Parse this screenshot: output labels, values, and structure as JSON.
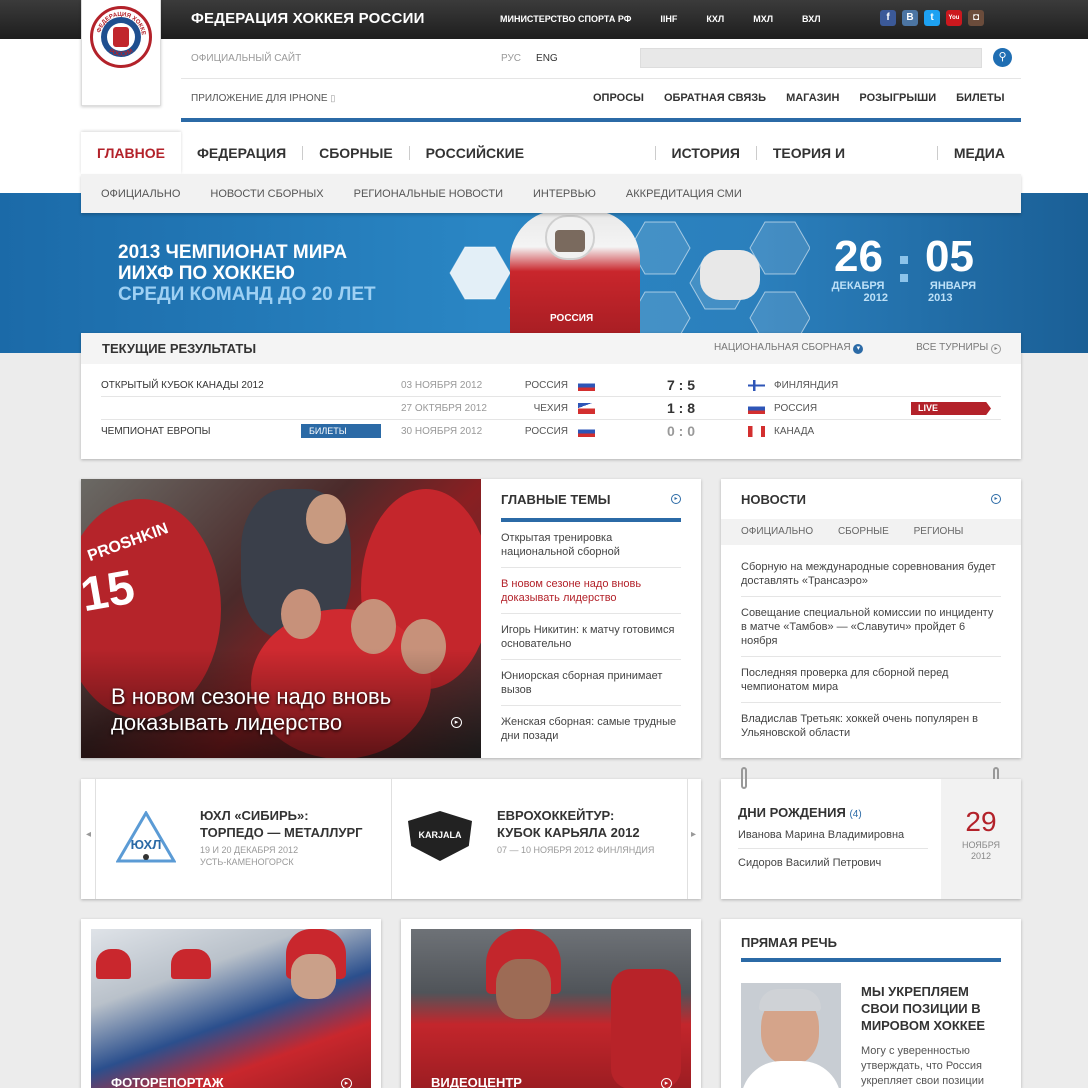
{
  "header": {
    "title": "ФЕДЕРАЦИЯ ХОККЕЯ РОССИИ",
    "links": [
      "МИНИСТЕРСТВО СПОРТА РФ",
      "IIHF",
      "КХЛ",
      "МХЛ",
      "ВХЛ"
    ],
    "social": [
      {
        "name": "facebook-icon",
        "glyph": "f",
        "color": "#3b5998"
      },
      {
        "name": "vkontakte-icon",
        "glyph": "B",
        "color": "#4c75a3"
      },
      {
        "name": "twitter-icon",
        "glyph": "t",
        "color": "#1da1f2"
      },
      {
        "name": "youtube-icon",
        "glyph": "You",
        "color": "#cc181e"
      },
      {
        "name": "instagram-icon",
        "glyph": "◘",
        "color": "#6b4c3b"
      }
    ],
    "official_site": "ОФИЦИАЛЬНЫЙ САЙТ",
    "lang_ru": "РУС",
    "lang_en": "ENG",
    "iphone_app": "ПРИЛОЖЕНИЕ ДЛЯ IPHONE",
    "util_links": [
      "ОПРОСЫ",
      "ОБРАТНАЯ СВЯЗЬ",
      "МАГАЗИН",
      "РОЗЫГРЫШИ",
      "БИЛЕТЫ"
    ],
    "logo_text": "ФЕДЕРАЦИЯ ХОККЕЯ РОССИИ"
  },
  "nav": {
    "main": [
      "ГЛАВНОЕ",
      "ФЕДЕРАЦИЯ",
      "СБОРНЫЕ",
      "РОССИЙСКИЕ СОРЕВНОВАНИЯ",
      "ИСТОРИЯ",
      "ТЕОРИЯ И МЕТОДИКА",
      "МЕДИА"
    ],
    "sub": [
      "ОФИЦИАЛЬНО",
      "НОВОСТИ СБОРНЫХ",
      "РЕГИОНАЛЬНЫЕ НОВОСТИ",
      "ИНТЕРВЬЮ",
      "АККРЕДИТАЦИЯ СМИ"
    ]
  },
  "banner": {
    "line1": "2013 ЧЕМПИОНАТ МИРА",
    "line2": "ИИХФ ПО ХОККЕЮ",
    "line3": "СРЕДИ КОМАНД ДО 20 ЛЕТ",
    "start_day": "26",
    "start_month": "ДЕКАБРЯ",
    "start_year": "2012",
    "end_day": "05",
    "end_month": "ЯНВАРЯ",
    "end_year": "2013",
    "jersey_text": "РОССИЯ"
  },
  "results": {
    "title": "ТЕКУЩИЕ РЕЗУЛЬТАТЫ",
    "filter": "НАЦИОНАЛЬНАЯ СБОРНАЯ",
    "all": "ВСЕ ТУРНИРЫ",
    "rows": [
      {
        "tournament": "ОТКРЫТЫЙ КУБОК КАНАДЫ 2012",
        "tickets": "",
        "date": "03 НОЯБРЯ 2012",
        "team1": "РОССИЯ",
        "flag1": "ru",
        "score": "7 : 5",
        "flag2": "fi",
        "team2": "ФИНЛЯНДИЯ",
        "live": ""
      },
      {
        "tournament": "",
        "tickets": "",
        "date": "27 ОКТЯБРЯ 2012",
        "team1": "ЧЕХИЯ",
        "flag1": "cz",
        "score": "1 : 8",
        "flag2": "ru",
        "team2": "РОССИЯ",
        "live": "LIVE"
      },
      {
        "tournament": "ЧЕМПИОНАТ ЕВРОПЫ",
        "tickets": "БИЛЕТЫ",
        "date": "30 НОЯБРЯ 2012",
        "team1": "РОССИЯ",
        "flag1": "ru",
        "score": "0 : 0",
        "flag2": "ca",
        "team2": "КАНАДА",
        "live": ""
      }
    ]
  },
  "feature": {
    "caption": "В новом сезоне надо вновь доказывать лидерство",
    "jersey_name": "PROSHKIN",
    "jersey_num": "15"
  },
  "topics": {
    "title": "ГЛАВНЫЕ ТЕМЫ",
    "items": [
      {
        "text": "Открытая тренировка национальной сборной",
        "hl": false
      },
      {
        "text": "В новом сезоне надо вновь доказывать лидерство",
        "hl": true
      },
      {
        "text": "Игорь Никитин: к матчу готовимся основательно",
        "hl": false
      },
      {
        "text": "Юниорская сборная принимает вызов",
        "hl": false
      },
      {
        "text": "Женская сборная: самые трудные дни позади",
        "hl": false
      }
    ]
  },
  "news": {
    "title": "НОВОСТИ",
    "tabs": [
      "ОФИЦИАЛЬНО",
      "СБОРНЫЕ",
      "РЕГИОНЫ"
    ],
    "items": [
      "Сборную на международные соревнования будет доставлять «Трансаэро»",
      "Совещание специальной комиссии по инциденту в матче «Тамбов» — «Славутич» пройдет 6 ноября",
      "Последняя проверка для сборной перед чемпионатом мира",
      "Владислав Третьяк: хоккей очень популярен в Ульяновской области"
    ]
  },
  "events": [
    {
      "title1": "ЮХЛ «СИБИРЬ»:",
      "title2": "ТОРПЕДО — МЕТАЛЛУРГ",
      "sub1": "19 И 20 ДЕКАБРЯ 2012",
      "sub2": "УСТЬ-КАМЕНОГОРСК",
      "logo": "ЮХЛ"
    },
    {
      "title1": "ЕВРОХОККЕЙТУР:",
      "title2": "КУБОК КАРЬЯЛА 2012",
      "sub1": "07 — 10 НОЯБРЯ 2012 ФИНЛЯНДИЯ",
      "sub2": "",
      "logo": "KARJALA"
    }
  ],
  "birthdays": {
    "title": "ДНИ РОЖДЕНИЯ",
    "count": "(4)",
    "names": [
      "Иванова Марина Владимировна",
      "Сидоров Василий Петрович"
    ],
    "day": "29",
    "month": "НОЯБРЯ",
    "year": "2012"
  },
  "bottom": {
    "photo_label": "ФОТОРЕПОРТАЖ",
    "video_label": "ВИДЕОЦЕНТР",
    "speech_title": "ПРЯМАЯ РЕЧЬ",
    "speech_headline": "МЫ УКРЕПЛЯЕМ СВОИ ПОЗИЦИИ В МИРОВОМ ХОККЕЕ",
    "speech_text": "Могу с уверенностью утверждать, что Россия укрепляет свои позиции"
  }
}
